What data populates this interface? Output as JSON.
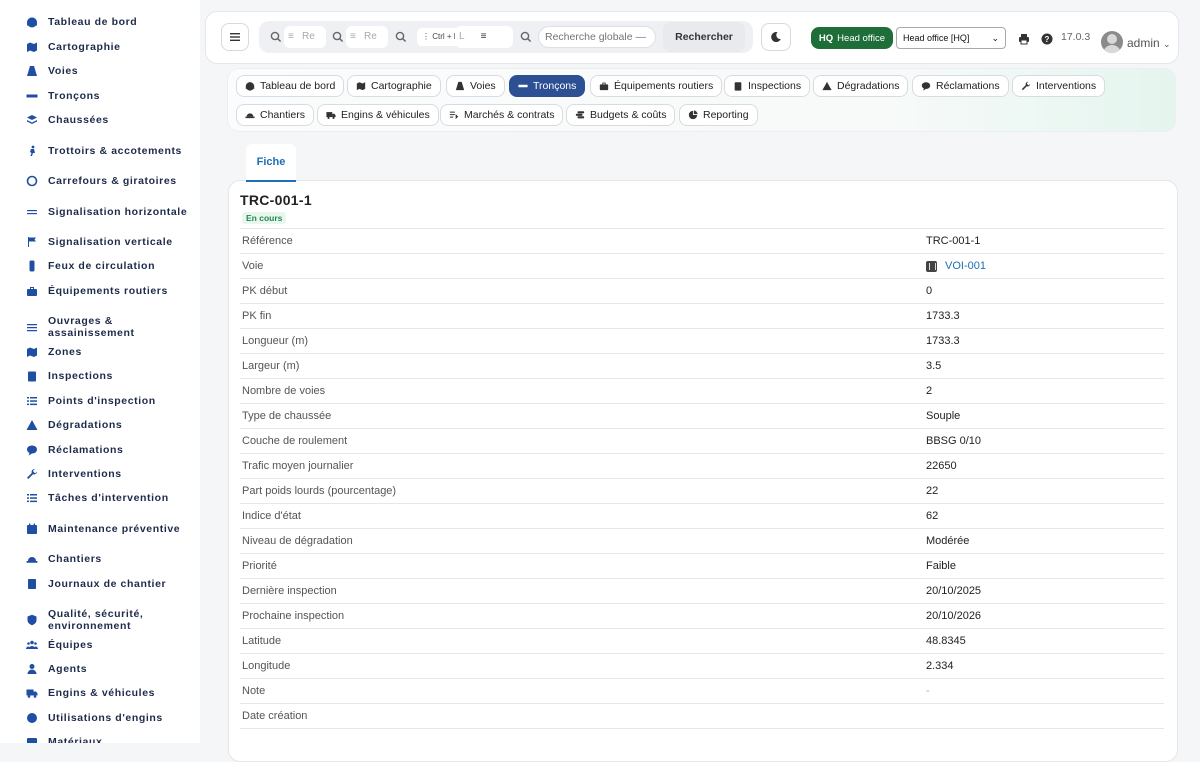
{
  "sidebar": {
    "items": [
      {
        "label": "Tableau de bord",
        "icon": "dashboard-icon"
      },
      {
        "label": "Cartographie",
        "icon": "map-icon"
      },
      {
        "label": "Voies",
        "icon": "road-icon"
      },
      {
        "label": "Tronçons",
        "icon": "segment-icon"
      },
      {
        "label": "Chaussées",
        "icon": "layers-icon"
      },
      {
        "label": "Trottoirs & accotements",
        "icon": "walk-icon"
      },
      {
        "label": "Carrefours & giratoires",
        "icon": "roundabout-icon"
      },
      {
        "label": "Signalisation horizontale",
        "icon": "lines-icon"
      },
      {
        "label": "Signalisation verticale",
        "icon": "sign-icon"
      },
      {
        "label": "Feux de circulation",
        "icon": "traffic-light-icon"
      },
      {
        "label": "Équipements routiers",
        "icon": "toolbox-icon"
      },
      {
        "label": "Ouvrages & assainissement",
        "icon": "water-icon"
      },
      {
        "label": "Zones",
        "icon": "zones-icon"
      },
      {
        "label": "Inspections",
        "icon": "clipboard-icon"
      },
      {
        "label": "Points d'inspection",
        "icon": "list-icon"
      },
      {
        "label": "Dégradations",
        "icon": "warning-icon"
      },
      {
        "label": "Réclamations",
        "icon": "chat-icon"
      },
      {
        "label": "Interventions",
        "icon": "wrench-icon"
      },
      {
        "label": "Tâches d'intervention",
        "icon": "tasks-icon"
      },
      {
        "label": "Maintenance préventive",
        "icon": "calendar-icon"
      },
      {
        "label": "Chantiers",
        "icon": "hardhat-icon"
      },
      {
        "label": "Journaux de chantier",
        "icon": "book-icon"
      },
      {
        "label": "Qualité, sécurité, environnement",
        "icon": "shield-icon"
      },
      {
        "label": "Équipes",
        "icon": "team-icon"
      },
      {
        "label": "Agents",
        "icon": "user-icon"
      },
      {
        "label": "Engins & véhicules",
        "icon": "truck-icon"
      },
      {
        "label": "Utilisations d'engins",
        "icon": "clock-icon"
      },
      {
        "label": "Matériaux",
        "icon": "box-icon"
      }
    ]
  },
  "header": {
    "mini_search_1": "Re",
    "mini_search_2": "Re",
    "ctrl_k": "Ctrl + K",
    "mini_search_3": "L",
    "global_search_placeholder": "Recherche globale — ctrl",
    "search_button": "Rechercher",
    "hq_code": "HQ",
    "hq_name": "Head office",
    "org_select": "Head office [HQ]",
    "version": "17.0.3",
    "user": "admin"
  },
  "module_tabs": [
    {
      "label": "Tableau de bord",
      "icon": "dashboard-icon",
      "active": false
    },
    {
      "label": "Cartographie",
      "icon": "map-icon",
      "active": false
    },
    {
      "label": "Voies",
      "icon": "road-icon",
      "active": false
    },
    {
      "label": "Tronçons",
      "icon": "segment-icon",
      "active": true
    },
    {
      "label": "Équipements routiers",
      "icon": "toolbox-icon",
      "active": false
    },
    {
      "label": "Inspections",
      "icon": "clipboard-icon",
      "active": false
    },
    {
      "label": "Dégradations",
      "icon": "warning-icon",
      "active": false
    },
    {
      "label": "Réclamations",
      "icon": "chat-icon",
      "active": false
    },
    {
      "label": "Interventions",
      "icon": "wrench-icon",
      "active": false
    },
    {
      "label": "Chantiers",
      "icon": "hardhat-icon",
      "active": false
    },
    {
      "label": "Engins & véhicules",
      "icon": "truck-icon",
      "active": false
    },
    {
      "label": "Marchés & contrats",
      "icon": "contract-icon",
      "active": false
    },
    {
      "label": "Budgets & coûts",
      "icon": "coins-icon",
      "active": false
    },
    {
      "label": "Reporting",
      "icon": "pie-icon",
      "active": false
    }
  ],
  "content": {
    "tab": "Fiche",
    "title": "TRC-001-1",
    "status": "En cours",
    "fields": [
      {
        "key": "Référence",
        "value": "TRC-001-1"
      },
      {
        "key": "Voie",
        "value": "VOI-001",
        "link": true
      },
      {
        "key": "PK début",
        "value": "0"
      },
      {
        "key": "PK fin",
        "value": "1733.3"
      },
      {
        "key": "Longueur (m)",
        "value": "1733.3"
      },
      {
        "key": "Largeur (m)",
        "value": "3.5"
      },
      {
        "key": "Nombre de voies",
        "value": "2"
      },
      {
        "key": "Type de chaussée",
        "value": "Souple"
      },
      {
        "key": "Couche de roulement",
        "value": "BBSG 0/10"
      },
      {
        "key": "Trafic moyen journalier",
        "value": "22650"
      },
      {
        "key": "Part poids lourds (pourcentage)",
        "value": "22"
      },
      {
        "key": "Indice d'état",
        "value": "62"
      },
      {
        "key": "Niveau de dégradation",
        "value": "Modérée"
      },
      {
        "key": "Priorité",
        "value": "Faible"
      },
      {
        "key": "Dernière inspection",
        "value": "20/10/2025"
      },
      {
        "key": "Prochaine inspection",
        "value": "20/10/2026"
      },
      {
        "key": "Latitude",
        "value": "48.8345"
      },
      {
        "key": "Longitude",
        "value": "2.334"
      },
      {
        "key": "Note",
        "value": "-",
        "muted": true
      },
      {
        "key": "Date création",
        "value": ""
      }
    ]
  },
  "colors": {
    "accent": "#2d4f93",
    "link": "#1f6fb5",
    "hq_badge": "#1e6e39",
    "status_green": "#1f8a4c"
  }
}
